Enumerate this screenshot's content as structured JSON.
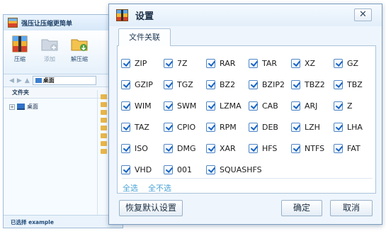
{
  "main_window": {
    "title": "强压让压缩更简单",
    "toolbar": [
      {
        "label": "压缩",
        "icon": "compress-icon",
        "enabled": true
      },
      {
        "label": "添加",
        "icon": "add-folder-icon",
        "enabled": false
      },
      {
        "label": "解压缩",
        "icon": "extract-icon",
        "enabled": true
      }
    ],
    "address": "桌面",
    "panel_title": "文件夹",
    "tree_item": "桌面",
    "status": "已选择 example"
  },
  "dialog": {
    "title": "设置",
    "close_label": "✕",
    "tab_label": "文件关联",
    "formats": [
      "ZIP",
      "7Z",
      "RAR",
      "TAR",
      "XZ",
      "GZ",
      "GZIP",
      "TGZ",
      "BZ2",
      "BZIP2",
      "TBZ2",
      "TBZ",
      "WIM",
      "SWM",
      "LZMA",
      "CAB",
      "ARJ",
      "Z",
      "TAZ",
      "CPIO",
      "RPM",
      "DEB",
      "LZH",
      "LHA",
      "ISO",
      "DMG",
      "XAR",
      "HFS",
      "NTFS",
      "FAT",
      "VHD",
      "001",
      "SQUASHFS"
    ],
    "all_checked": true,
    "select_all": "全选",
    "select_none": "全不选",
    "restore_button": "恢复默认设置",
    "ok_button": "确定",
    "cancel_button": "取消"
  },
  "colors": {
    "checkbox_check": "#1763c4",
    "link": "#4aa3d6",
    "dialog_bg": "#eef5fc",
    "border": "#7a9cc0"
  }
}
